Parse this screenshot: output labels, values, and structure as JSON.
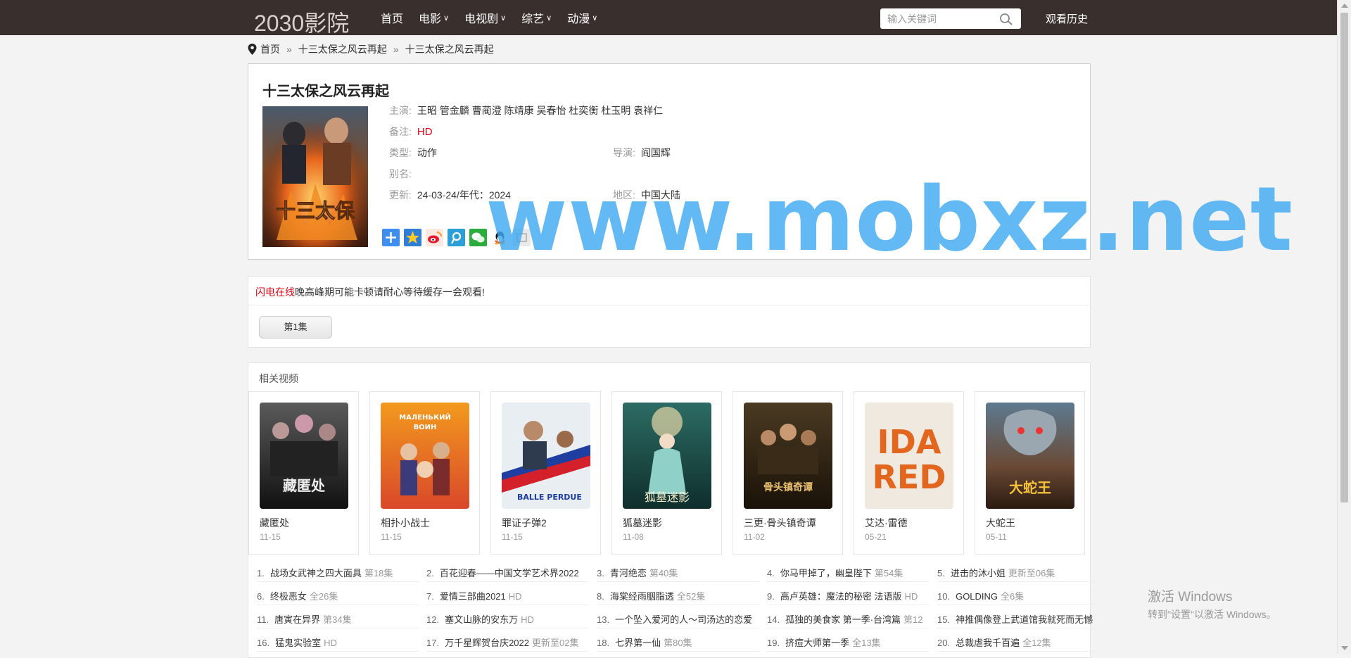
{
  "header": {
    "logo": "2030影院",
    "nav": [
      {
        "label": "首页",
        "dropdown": false
      },
      {
        "label": "电影",
        "dropdown": true
      },
      {
        "label": "电视剧",
        "dropdown": true
      },
      {
        "label": "综艺",
        "dropdown": true
      },
      {
        "label": "动漫",
        "dropdown": true
      }
    ],
    "search_placeholder": "输入关键词",
    "history_label": "观看历史"
  },
  "breadcrumb": {
    "home": "首页",
    "sep": "»",
    "items": [
      "十三太保之风云再起",
      "十三太保之风云再起"
    ]
  },
  "detail": {
    "title": "十三太保之风云再起",
    "cast_label": "主演:",
    "cast": "王昭 管金麟 曹蔺澄 陈靖康 吴春怡 杜奕衡 杜玉明 袁祥仁",
    "remark_label": "备注:",
    "remark": "HD",
    "type_label": "类型:",
    "type": "动作",
    "director_label": "导演:",
    "director": "阎国辉",
    "alias_label": "别名:",
    "alias": "",
    "update_label": "更新:",
    "update": "24-03-24/年代：2024",
    "region_label": "地区:",
    "region": "中国大陆"
  },
  "share_icons": [
    "plus-share-icon",
    "qzone-icon",
    "weibo-icon",
    "tencent-weibo-icon",
    "wechat-icon",
    "qq-icon",
    "other-share-icon"
  ],
  "notice": {
    "highlight": "闪电在线",
    "text": "晚高峰期可能卡顿请耐心等待缓存一会观看!"
  },
  "episodes": [
    "第1集"
  ],
  "related": {
    "title": "相关视频",
    "items": [
      {
        "name": "藏匿处",
        "date": "11-15"
      },
      {
        "name": "相扑小战士",
        "date": "11-15"
      },
      {
        "name": "罪证子弹2",
        "date": "11-15"
      },
      {
        "name": "狐墓迷影",
        "date": "11-08"
      },
      {
        "name": "三更·骨头镇奇谭",
        "date": "11-02"
      },
      {
        "name": "艾达·雷德",
        "date": "05-21"
      },
      {
        "name": "大蛇王",
        "date": "05-11"
      }
    ]
  },
  "ranking": [
    {
      "num": "1.",
      "title": "战场女武神之四大面具",
      "extra": "第18集"
    },
    {
      "num": "2.",
      "title": "百花迎春——中国文学艺术界2022",
      "extra": ""
    },
    {
      "num": "3.",
      "title": "青河绝恋",
      "extra": "第40集"
    },
    {
      "num": "4.",
      "title": "你马甲掉了，幽皇陛下",
      "extra": "第54集"
    },
    {
      "num": "5.",
      "title": "进击的沐小姐",
      "extra": "更新至06集"
    },
    {
      "num": "6.",
      "title": "终极恶女",
      "extra": "全26集"
    },
    {
      "num": "7.",
      "title": "爱情三部曲2021",
      "extra": "HD"
    },
    {
      "num": "8.",
      "title": "海棠经雨胭脂透",
      "extra": "全52集"
    },
    {
      "num": "9.",
      "title": "高卢英雄：魔法的秘密 法语版",
      "extra": "HD"
    },
    {
      "num": "10.",
      "title": "GOLDING",
      "extra": "全6集"
    },
    {
      "num": "11.",
      "title": "唐寅在异界",
      "extra": "第34集"
    },
    {
      "num": "12.",
      "title": "塞文山脉的安东万",
      "extra": "HD"
    },
    {
      "num": "13.",
      "title": "一个坠入爱河的人～司汤达的恋爱",
      "extra": ""
    },
    {
      "num": "14.",
      "title": "孤独的美食家 第一季·台湾篇",
      "extra": "第12"
    },
    {
      "num": "15.",
      "title": "神推偶像登上武道馆我就死而无憾",
      "extra": ""
    },
    {
      "num": "16.",
      "title": "猛鬼实验室",
      "extra": "HD"
    },
    {
      "num": "17.",
      "title": "万千星辉贺台庆2022",
      "extra": "更新至02集"
    },
    {
      "num": "18.",
      "title": "七界第一仙",
      "extra": "第80集"
    },
    {
      "num": "19.",
      "title": "挤痘大师第一季",
      "extra": "全13集"
    },
    {
      "num": "20.",
      "title": "总裁虐我千百遍",
      "extra": "全12集"
    }
  ],
  "watermark": "www.mobxz.net",
  "windows_activation": {
    "line1": "激活 Windows",
    "line2": "转到\"设置\"以激活 Windows。"
  }
}
